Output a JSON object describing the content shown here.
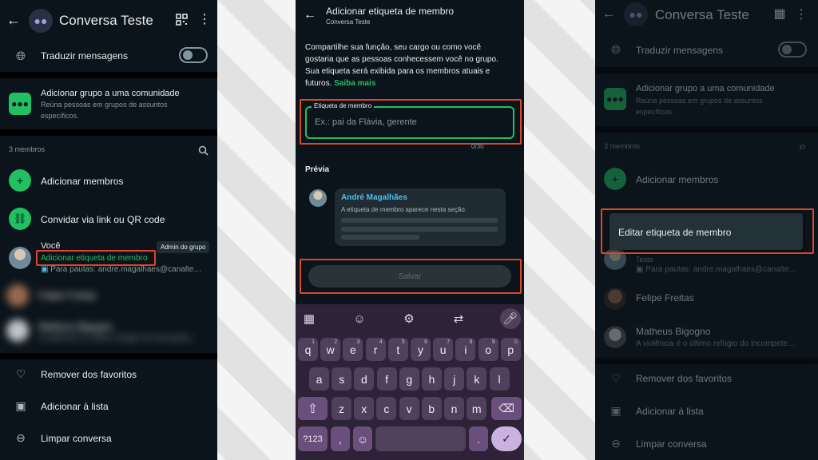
{
  "panel1": {
    "title": "Conversa Teste",
    "translate_label": "Traduzir mensagens",
    "community_title": "Adicionar grupo a uma comunidade",
    "community_sub_1": "Reúna pessoas em grupos de assuntos",
    "community_sub_2": "específicos.",
    "members_count": "3 membros",
    "add_members": "Adicionar membros",
    "invite_link": "Convidar via link ou QR code",
    "you_name": "Você",
    "admin_badge": "Admin do grupo",
    "add_tag_link": "Adicionar etiqueta de membro",
    "you_status": "Para pautas: andre.magalhaes@canalte…",
    "blur1": "Felipe Freitas",
    "blur2": "Matheus Bigogno",
    "blur2_sub": "A violência é o último refúgio do incompete…",
    "remove_fav": "Remover dos favoritos",
    "add_list": "Adicionar à lista",
    "clear_chat": "Limpar conversa"
  },
  "panel2": {
    "title": "Adicionar etiqueta de membro",
    "subtitle": "Conversa Teste",
    "desc_1": "Compartilhe sua função, seu cargo ou como você",
    "desc_2": "gostaria que as pessoas conhecessem você no grupo.",
    "desc_3": "Sua etiqueta será exibida para os membros atuais e",
    "desc_4": "futuros.",
    "learn_more": "Saiba mais",
    "field_label": "Etiqueta de membro",
    "field_placeholder": "Ex.: pai da Flávia, gerente",
    "counter": "0/30",
    "preview_label": "Prévia",
    "preview_name": "André Magalhães",
    "preview_text": "A etiqueta de membro aparece nesta seção.",
    "save": "Salvar",
    "keys_row1": [
      "q",
      "w",
      "e",
      "r",
      "t",
      "y",
      "u",
      "i",
      "o",
      "p"
    ],
    "keys_row1_hints": [
      "1",
      "2",
      "3",
      "4",
      "5",
      "6",
      "7",
      "8",
      "9",
      "0"
    ],
    "keys_row2": [
      "a",
      "s",
      "d",
      "f",
      "g",
      "h",
      "j",
      "k",
      "l"
    ],
    "keys_row3": [
      "z",
      "x",
      "c",
      "v",
      "b",
      "n",
      "m"
    ],
    "key_symbols": "?123",
    "key_comma": ",",
    "key_period": "."
  },
  "panel3": {
    "title": "Conversa Teste",
    "translate_label": "Traduzir mensagens",
    "community_title": "Adicionar grupo a uma comunidade",
    "community_sub_1": "Reúna pessoas em grupos de assuntos",
    "community_sub_2": "específicos.",
    "members_count": "3 membros",
    "add_members": "Adicionar membros",
    "popup_item": "Editar etiqueta de membro",
    "you_tag": "Teste",
    "you_status": "Para pautas: andre.magalhaes@canalte…",
    "member1": "Felipe Freitas",
    "member2": "Matheus Bigogno",
    "member2_sub": "A violência é o último refúgio do incompete…",
    "remove_fav": "Remover dos favoritos",
    "add_list": "Adicionar à lista",
    "clear_chat": "Limpar conversa"
  },
  "colors": {
    "background": "#0b141a",
    "accent_green": "#21c063",
    "highlight_red": "#e0442c",
    "link_blue": "#53bdeb"
  }
}
